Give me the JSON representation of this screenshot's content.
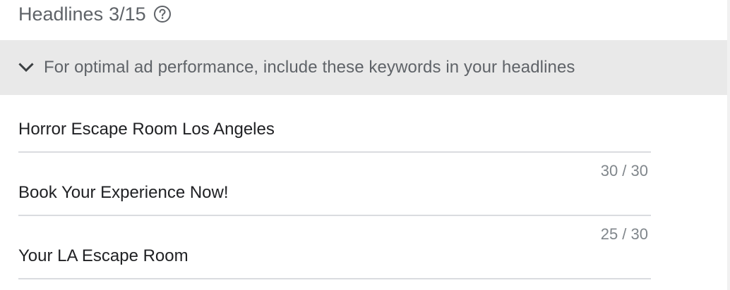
{
  "header": {
    "title": "Headlines",
    "count": "3/15",
    "help_icon": "help-circle-icon"
  },
  "banner": {
    "icon": "chevron-down-icon",
    "text": "For optimal ad performance, include these keywords in your headlines"
  },
  "headlines": [
    {
      "value": "Horror Escape Room Los Angeles",
      "counter": "30 / 30"
    },
    {
      "value": "Book Your Experience Now!",
      "counter": "25 / 30"
    },
    {
      "value": "Your LA Escape Room",
      "counter": ""
    }
  ]
}
